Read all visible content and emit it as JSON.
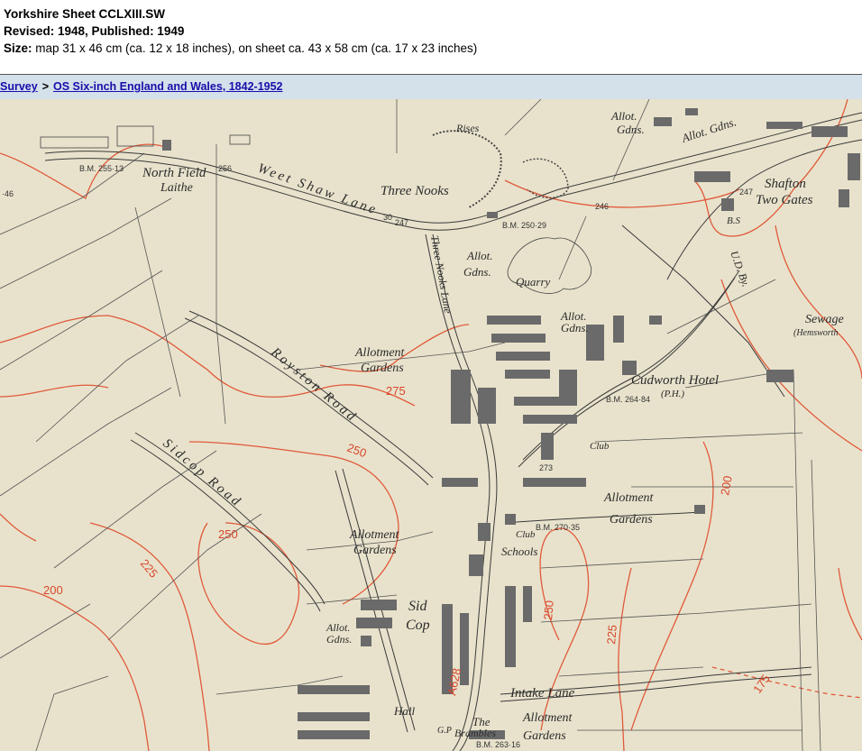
{
  "sheet": {
    "title": "Yorkshire Sheet CCLXIII.SW",
    "revised_line": "Revised: 1948, Published: 1949",
    "size_label": "Size:",
    "size_text": " map 31 x 46 cm (ca. 12 x 18 inches), on sheet ca. 43 x 58 cm (ca. 17 x 23 inches)"
  },
  "breadcrumb": {
    "item1": "Survey",
    "separator": ">",
    "item2": "OS Six-inch England and Wales, 1842-1952"
  },
  "map": {
    "colors": {
      "paper": "#e8e2cc",
      "contour": "#e05a3a",
      "ink": "#3a3a3a"
    },
    "labels": {
      "north_field": "North Field",
      "laithe": "Laithe",
      "weet_shaw_lane": "Weet Shaw Lane",
      "three_nooks": "Three Nooks",
      "three_nooks_lane": "Three Nooks Lane",
      "rises": "Rises",
      "allot_gdns_1": "Allot.",
      "gdns_1": "Gdns.",
      "allot_gdns_2": "Allot. Gdns.",
      "allot_gdns_3": "Allot.",
      "gdns_3": "Gdns.",
      "quarry": "Quarry",
      "allot_gdns_4": "Allot.",
      "gdns_4": "Gdns.",
      "shafton": "Shafton",
      "two_gates": "Two Gates",
      "bs": "B.S",
      "ud_by": "U.D. By.",
      "sewage": "Sewage",
      "hemsworth": "(Hemsworth",
      "allotment_gardens_1": "Allotment",
      "gardens_1": "Gardens",
      "royston_road": "Royston Road",
      "cudworth_hotel": "Cudworth Hotel",
      "ph": "(P.H.)",
      "sidcop_road": "Sidcop Road",
      "club_1": "Club",
      "allotment_gardens_2": "Allotment",
      "gardens_2": "Gardens",
      "allotment_gardens_3": "Allotment",
      "gardens_3": "Gardens",
      "club_2": "Club",
      "schools": "Schools",
      "sid": "Sid",
      "cop": "Cop",
      "allot_gdns_5": "Allot.",
      "gdns_5": "Gdns.",
      "intake_lane": "Intake Lane",
      "allotment_gardens_4": "Allotment",
      "gardens_4": "Gardens",
      "hall": "Hall",
      "the": "The",
      "brambles": "Brambles",
      "gp": "G.P",
      "a628": "A628"
    },
    "benchmarks": {
      "bm_255": "B.M. 255·13",
      "h_256": "256",
      "h_247a": "247",
      "bm_250": "B.M. 250·29",
      "h_246": "246",
      "h_247b": "247",
      "bm_264": "B.M. 264·84",
      "bm_270": "B.M. 270·35",
      "h_273": "273",
      "bm_263": "B.M. 263·16",
      "h_46": "·46",
      "h_30": "30"
    },
    "contours": {
      "c275": "275",
      "c250a": "250",
      "c250b": "250",
      "c225a": "225",
      "c200a": "200",
      "c250c": "250",
      "c225b": "225",
      "c200b": "200",
      "c175": "175"
    }
  }
}
